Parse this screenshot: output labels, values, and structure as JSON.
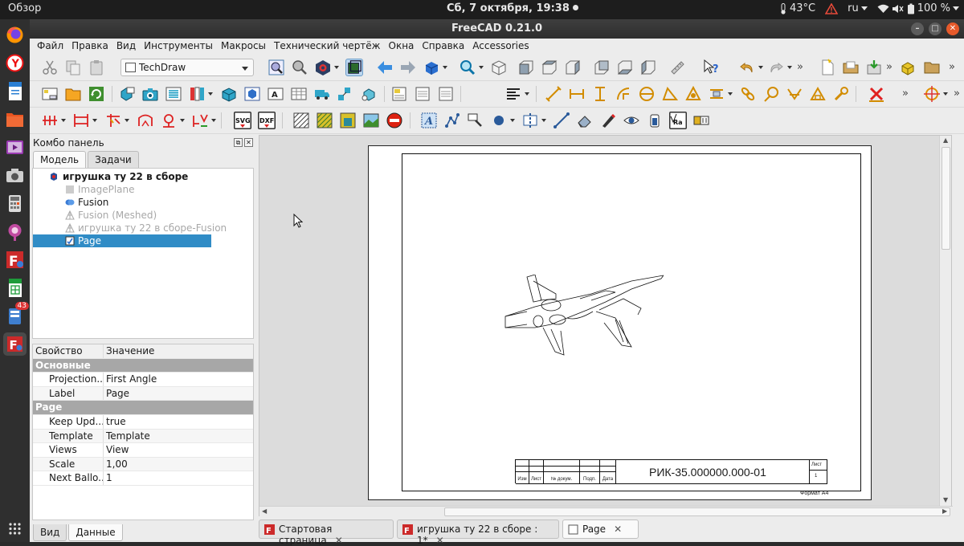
{
  "topbar": {
    "overview": "Обзор",
    "clock": "Сб, 7 октября, 19:38",
    "temperature": "43°C",
    "language": "ru",
    "battery": "100 %"
  },
  "dock": {
    "badge_count": "43"
  },
  "window": {
    "title": "FreeCAD 0.21.0"
  },
  "menubar": [
    "Файл",
    "Правка",
    "Вид",
    "Инструменты",
    "Макросы",
    "Технический чертёж",
    "Окна",
    "Справка",
    "Accessories"
  ],
  "toolbar": {
    "workbench": "TechDraw"
  },
  "combo": {
    "title": "Комбо панель",
    "tabs": [
      "Модель",
      "Задачи"
    ],
    "tree": [
      {
        "label": "игрушка ту 22 в сборе"
      },
      {
        "label": "ImagePlane"
      },
      {
        "label": "Fusion"
      },
      {
        "label": "Fusion (Meshed)"
      },
      {
        "label": "игрушка ту 22 в сборе-Fusion"
      },
      {
        "label": "Page"
      }
    ],
    "props_header": {
      "key": "Свойство",
      "value": "Значение"
    },
    "groups": {
      "basic": "Основные",
      "page": "Page"
    },
    "props": [
      {
        "key": "Projection...",
        "value": "First Angle"
      },
      {
        "key": "Label",
        "value": "Page"
      },
      {
        "key": "Keep Upd...",
        "value": "true"
      },
      {
        "key": "Template",
        "value": "Template"
      },
      {
        "key": "Views",
        "value": "View"
      },
      {
        "key": "Scale",
        "value": "1,00"
      },
      {
        "key": "Next Ballo...",
        "value": "1"
      }
    ],
    "bottom_tabs": [
      "Вид",
      "Данные"
    ]
  },
  "titleblock": {
    "code": "РИК-35.000000.000-01",
    "labels": {
      "izm": "Изм",
      "list": "Лист",
      "doc": "№ докум.",
      "sign": "Подп.",
      "date": "Дата"
    },
    "sheet_label": "Лист",
    "sheet_number": "1",
    "format": "Формат А4"
  },
  "doc_tabs": [
    {
      "label": "Стартовая страница"
    },
    {
      "label": "игрушка ту 22 в сборе : 1*"
    },
    {
      "label": "Page"
    }
  ],
  "colors": {
    "selection": "#308cc6",
    "close_button": "#e65a2b",
    "ubuntu_accent": "#e95420"
  }
}
